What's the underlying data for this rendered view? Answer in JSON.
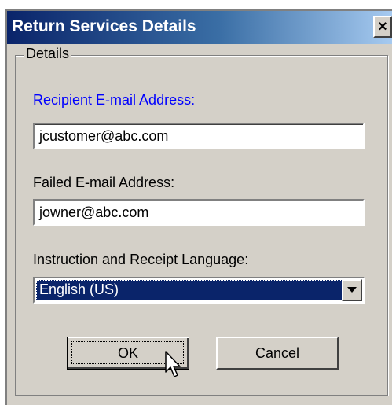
{
  "window": {
    "title": "Return Services Details",
    "close_glyph": "×",
    "close_icon": "close-icon"
  },
  "group": {
    "legend": "Details"
  },
  "fields": {
    "recipient": {
      "label": "Recipient E-mail Address:",
      "value": "jcustomer@abc.com",
      "label_color": "#0000ff"
    },
    "failed": {
      "label": "Failed E-mail Address:",
      "value": "jowner@abc.com"
    },
    "language": {
      "label": "Instruction and Receipt Language:",
      "selected": "English (US)",
      "arrow_icon": "dropdown-arrow-icon"
    }
  },
  "buttons": {
    "ok_label": "OK",
    "cancel_rest": "ancel",
    "cancel_mnemonic": "C"
  },
  "colors": {
    "title_bar": "#0a246a",
    "dialog_bg": "#d4d0c8",
    "selection": "#0a246a"
  },
  "cursor_icon": "mouse-pointer-icon"
}
